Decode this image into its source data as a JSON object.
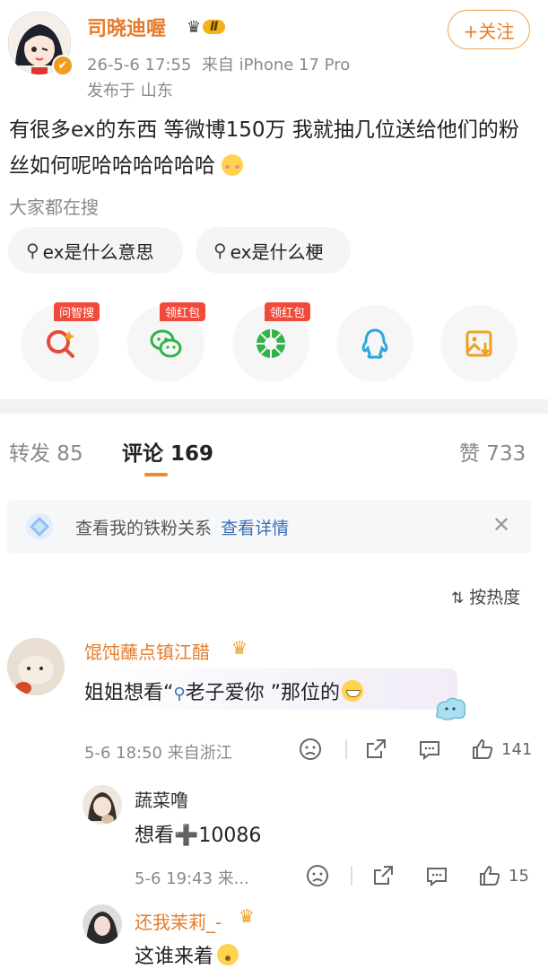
{
  "post": {
    "author": "司晓迪喔",
    "level_badge": "Ⅱ",
    "timestamp": "26-5-6 17:55",
    "source": "来自 iPhone 17 Pro",
    "location": "发布于 山东",
    "follow_label": "+关注",
    "text": "有很多ex的东西 等微博150万 我就抽几位送给他们的粉丝如何呢哈哈哈哈哈哈"
  },
  "search": {
    "label": "大家都在搜",
    "chips": [
      "ex是什么意思",
      "ex是什么梗"
    ]
  },
  "share": {
    "items": [
      {
        "icon": "ai-search-icon",
        "tag": "问智搜"
      },
      {
        "icon": "wechat-icon",
        "tag": "领红包"
      },
      {
        "icon": "moments-icon",
        "tag": "领红包"
      },
      {
        "icon": "qq-icon",
        "tag": ""
      },
      {
        "icon": "save-image-icon",
        "tag": ""
      }
    ]
  },
  "tabs": {
    "repost": "转发 85",
    "comments": "评论 169",
    "likes": "赞 733"
  },
  "banner": {
    "text": "查看我的铁粉关系",
    "link": "查看详情"
  },
  "sort_label": "按热度",
  "comments": [
    {
      "name": "馄饨蘸点镇江醋",
      "text": "姐姐想看“",
      "search_term": "老子爱你",
      "text_after": " ”那位的",
      "time": "5-6 18:50 来自浙江",
      "likes": "141"
    }
  ],
  "replies": [
    {
      "name": "蔬菜噜",
      "text": "想看➕10086",
      "time": "5-6 19:43 来...",
      "likes": "15"
    },
    {
      "name": "还我茉莉_-",
      "text": "这谁来着"
    }
  ],
  "colors": {
    "accent": "#e57c2a",
    "link": "#3a6fb5",
    "tag_red": "#f24a3a",
    "wechat": "#30b44a",
    "qq": "#2aa8e0",
    "save": "#f0a020"
  }
}
